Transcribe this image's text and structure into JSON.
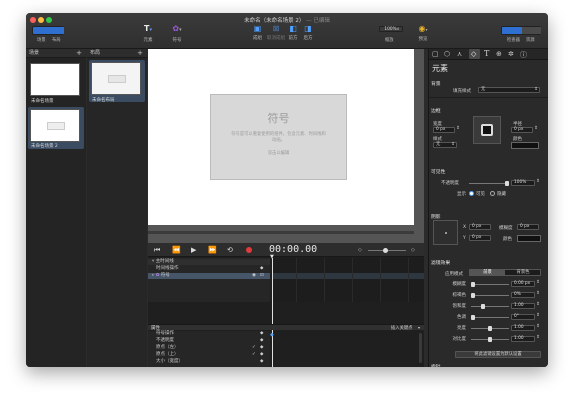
{
  "window": {
    "title": "未命名（未命名场景 2）",
    "title_status": "— 已编辑"
  },
  "toolbar": {
    "left": {
      "scene_label": "场景",
      "layout_label": "布局"
    },
    "element_label": "元素",
    "symbol_label": "符号",
    "actions": [
      {
        "label": "成组",
        "icon": "group-icon"
      },
      {
        "label": "取消成组",
        "icon": "ungroup-icon"
      },
      {
        "label": "前方",
        "icon": "bring-forward-icon"
      },
      {
        "label": "后方",
        "icon": "send-backward-icon"
      }
    ],
    "zoom_value": "100%",
    "zoom_label": "缩放",
    "preview_label": "预览",
    "right": {
      "inspector_label": "检查器",
      "library_label": "资源"
    }
  },
  "scenes_panel": {
    "title": "场景",
    "add": "+",
    "items": [
      {
        "name": "未命名场景",
        "selected": false
      },
      {
        "name": "未命名场景 2",
        "selected": true
      }
    ]
  },
  "layouts_panel": {
    "title": "布局",
    "add": "+",
    "items": [
      {
        "name": "未命名布局"
      }
    ]
  },
  "canvas": {
    "symbol_title": "符号",
    "symbol_desc": "符号是可以重复使用的组件。包含元素、时间线和动画。",
    "symbol_edit": "双击以编辑"
  },
  "timeline": {
    "time": "00:00.00",
    "tracks": [
      {
        "label": "主时间线"
      },
      {
        "label": "时间线操作"
      },
      {
        "label": "符号"
      }
    ],
    "props_header": "属性",
    "insert_keyframe": "插入关键点",
    "props": [
      "符号操作",
      "不透明度",
      "原点（左）",
      "原点（上）",
      "大小（宽度）"
    ]
  },
  "inspector": {
    "title": "元素",
    "background": {
      "heading": "背景",
      "fill_style_label": "填充样式",
      "fill_style_value": "无"
    },
    "border": {
      "heading": "边框",
      "width_label": "宽度",
      "width_value": "0 px",
      "radius_label": "半径",
      "radius_value": "0 px",
      "style_label": "样式",
      "style_value": "无",
      "color_label": "颜色"
    },
    "visibility": {
      "heading": "可见性",
      "opacity_label": "不透明度",
      "opacity_value": "100%",
      "display_label": "显示",
      "visible_label": "可见",
      "hidden_label": "隐藏"
    },
    "shadow": {
      "heading": "阴影",
      "x_label": "X",
      "x_value": "0 px",
      "y_label": "Y",
      "y_value": "0 px",
      "blur_label": "模糊度",
      "blur_value": "0 px",
      "color_label": "颜色"
    },
    "filters": {
      "heading": "滤镜效果",
      "apply_label": "应用模式",
      "tab_foreground": "前景",
      "tab_background": "背景色",
      "rows": [
        {
          "label": "模糊度",
          "value": "0.00 px",
          "fraction": 0.0
        },
        {
          "label": "棕褐色",
          "value": "0%",
          "fraction": 0.0
        },
        {
          "label": "饱和度",
          "value": "1.00",
          "fraction": 0.3
        },
        {
          "label": "色调",
          "value": "0°",
          "fraction": 0.0
        },
        {
          "label": "亮度",
          "value": "1.00",
          "fraction": 0.5
        },
        {
          "label": "对比度",
          "value": "1.00",
          "fraction": 0.5
        }
      ],
      "reset_button": "将此滤镜设置为默认设置"
    },
    "next_heading": "指针"
  },
  "colors": {
    "accent": "#5f8fd0",
    "record": "#e23b3b",
    "playhead": "#e0e0e0"
  }
}
